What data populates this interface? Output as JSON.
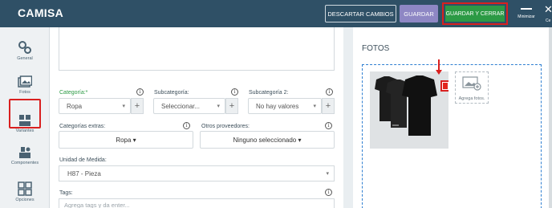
{
  "header": {
    "title": "CAMISA",
    "discard_label": "DESCARTAR CAMBIOS",
    "save_label": "GUARDAR",
    "save_close_label": "GUARDAR Y CERRAR",
    "minimize_label": "Minimizar",
    "close_label": "Ce"
  },
  "sidebar": {
    "items": [
      {
        "label": "General",
        "icon": "gears-icon"
      },
      {
        "label": "Fotos",
        "icon": "photos-icon"
      },
      {
        "label": "Variantes",
        "icon": "boxes-icon"
      },
      {
        "label": "Componentes",
        "icon": "components-icon"
      },
      {
        "label": "Opciones",
        "icon": "grid-icon"
      }
    ]
  },
  "form": {
    "categoria": {
      "label": "Categoría:*",
      "value": "Ropa"
    },
    "subcategoria": {
      "label": "Subcategoría:",
      "value": "Seleccionar..."
    },
    "subcategoria2": {
      "label": "Subcategoría 2:",
      "value": "No hay valores"
    },
    "categorias_extras": {
      "label": "Categorías extras:",
      "value": "Ropa ▾"
    },
    "otros_proveedores": {
      "label": "Otros proveedores:",
      "value": "Ninguno seleccionado ▾"
    },
    "unidad_medida": {
      "label": "Unidad de Medida:",
      "value": "H87 - Pieza"
    },
    "tags": {
      "label": "Tags:",
      "placeholder": "Agrega tags y da enter..."
    }
  },
  "fotos": {
    "title": "FOTOS",
    "add_label": "Agrega fotos."
  },
  "colors": {
    "header_bg": "#2f5066",
    "save_close": "#2c9a45",
    "save": "#8e87c4",
    "highlight": "#d9201f",
    "dropzone_border": "#2f7fd1"
  }
}
